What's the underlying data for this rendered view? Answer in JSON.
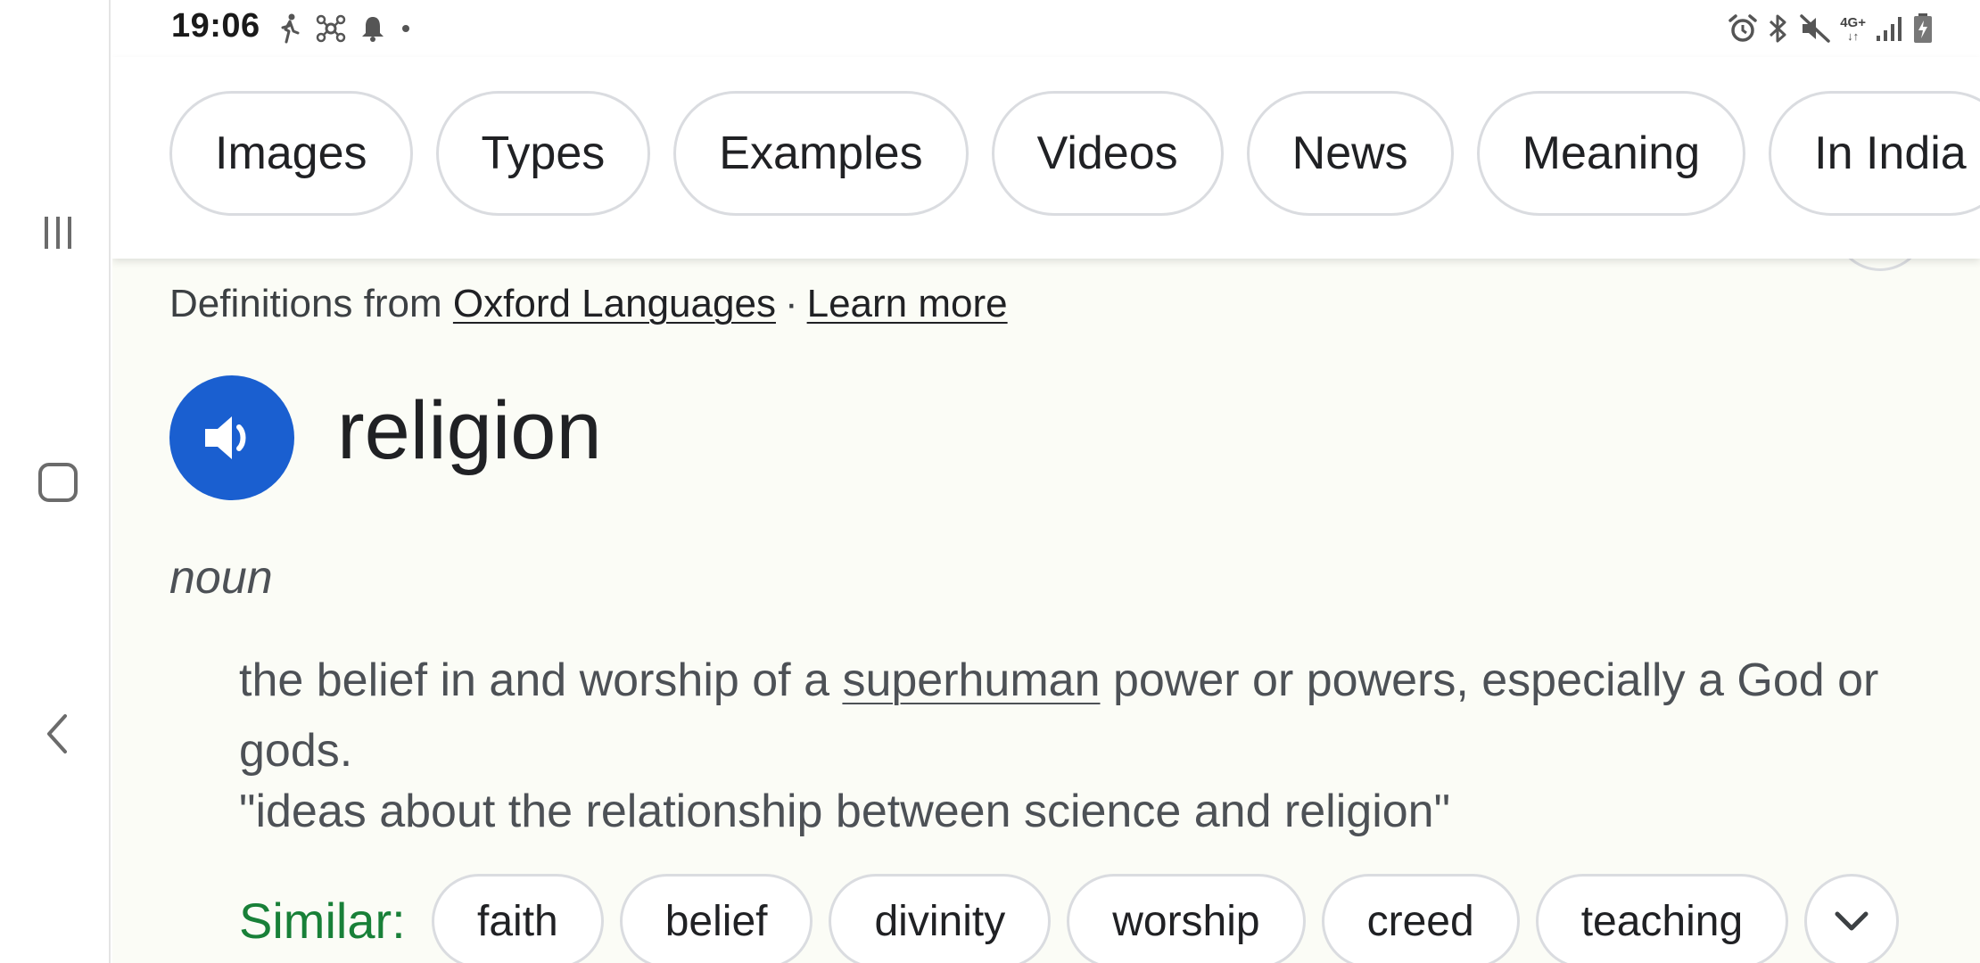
{
  "status_bar": {
    "time": "19:06",
    "left_icons": [
      "walking-icon",
      "network-hub-icon",
      "bell-icon",
      "dot-icon"
    ],
    "right_icons": [
      "alarm-icon",
      "bluetooth-icon",
      "mute-icon",
      "signal-icon",
      "battery-charging-icon"
    ],
    "network_type": "4G+",
    "network_arrows": "↓↑"
  },
  "nav": {
    "items": [
      "recents-icon",
      "home-icon",
      "back-icon"
    ]
  },
  "chips": [
    "Images",
    "Types",
    "Examples",
    "Videos",
    "News",
    "Meaning",
    "In India"
  ],
  "source": {
    "prefix": "Definitions from",
    "provider": "Oxford Languages",
    "separator": "·",
    "learn_more": "Learn more"
  },
  "entry": {
    "word": "religion",
    "part_of_speech": "noun",
    "definition_before": "the belief in and worship of a ",
    "definition_link": "superhuman",
    "definition_after": " power or powers, especially a God or gods.",
    "example": "\"ideas about the relationship between science and religion\""
  },
  "similar": {
    "label": "Similar:",
    "words": [
      "faith",
      "belief",
      "divinity",
      "worship",
      "creed",
      "teaching"
    ]
  },
  "colors": {
    "speaker_blue": "#1a5fd0",
    "similar_green": "#188038",
    "page_bg": "#fbfcf6"
  }
}
